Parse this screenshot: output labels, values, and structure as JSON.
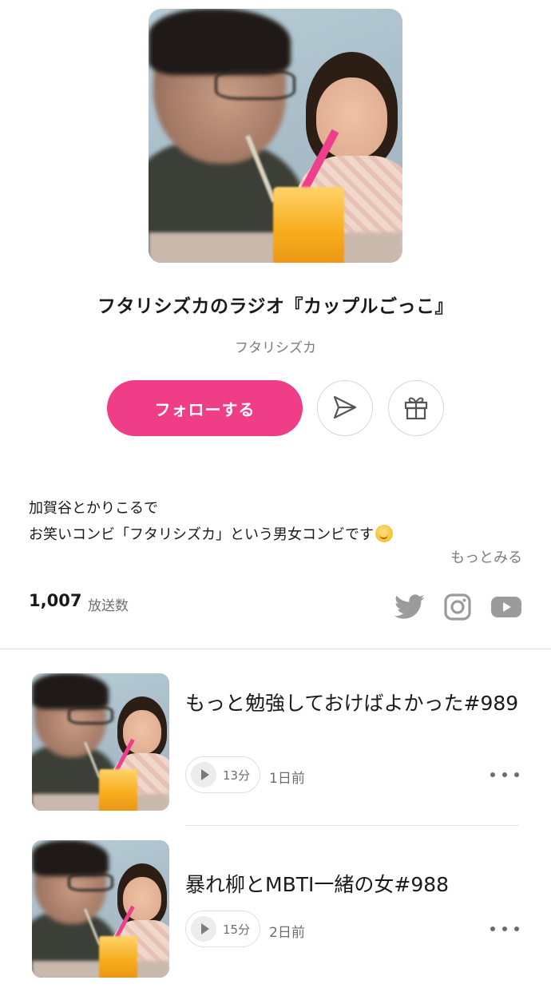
{
  "podcast": {
    "title": "フタリシズカのラジオ『カップルごっこ』",
    "author": "フタリシズカ",
    "follow_label": "フォローする",
    "description_lines": [
      "加賀谷とかりこるで",
      "お笑いコンビ「フタリシズカ」という男女コンビです"
    ],
    "more_label": "もっとみる",
    "episode_count": "1,007",
    "episode_count_label": "放送数",
    "accent_color": "#f03d87"
  },
  "icons": {
    "share": "send-icon",
    "gift": "gift-icon",
    "social": [
      "twitter-icon",
      "instagram-icon",
      "youtube-icon"
    ],
    "emoji": "sun-emoji-icon"
  },
  "episodes": [
    {
      "title": "もっと勉強しておけばよかった#989",
      "duration": "13分",
      "ago": "1日前"
    },
    {
      "title": "暴れ柳とMBTI一緒の女#988",
      "duration": "15分",
      "ago": "2日前"
    }
  ]
}
